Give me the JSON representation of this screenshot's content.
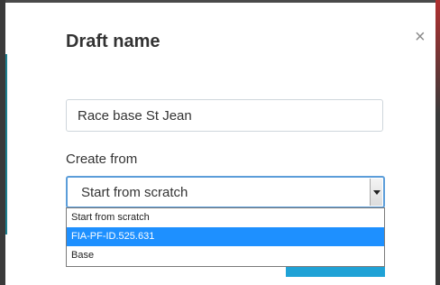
{
  "dialog": {
    "title": "Draft name",
    "close_glyph": "×"
  },
  "name_field": {
    "value": "Race base St Jean"
  },
  "create_from": {
    "label": "Create from",
    "selected": "Start from scratch",
    "options": [
      {
        "label": "Start from scratch"
      },
      {
        "label": "FIA-PF-ID.525.631"
      },
      {
        "label": "Base"
      }
    ],
    "highlighted_index": 1
  },
  "icons": {
    "close": "close-icon",
    "dropdown": "chevron-down-icon"
  },
  "colors": {
    "highlight": "#1e90ff",
    "focus_border": "#5b9dd9",
    "primary_button": "#1fa2d6"
  }
}
